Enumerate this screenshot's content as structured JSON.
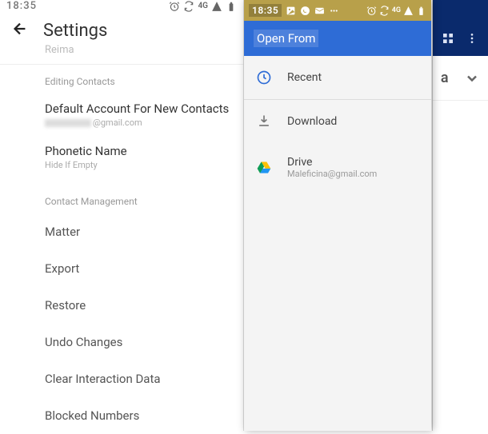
{
  "left": {
    "status": {
      "time": "18:35",
      "network": "4G"
    },
    "title": "Settings",
    "faded": "Reima",
    "section_editing": "Editing Contacts",
    "default_account": {
      "title": "Default Account For New Contacts",
      "sub_suffix": "@gmail.com"
    },
    "phonetic": {
      "title": "Phonetic Name",
      "sub": "Hide If Empty"
    },
    "section_mgmt": "Contact Management",
    "items": {
      "matter": "Matter",
      "export": "Export",
      "restore": "Restore",
      "undo": "Undo Changes",
      "clear": "Clear Interaction Data",
      "blocked": "Blocked Numbers"
    }
  },
  "right": {
    "status": {
      "time": "18:35",
      "network": "4G"
    },
    "drawer_title": "Open From",
    "recent": "Recent",
    "download": "Download",
    "drive": {
      "label": "Drive",
      "email": "Maleficina@gmail.com"
    }
  }
}
